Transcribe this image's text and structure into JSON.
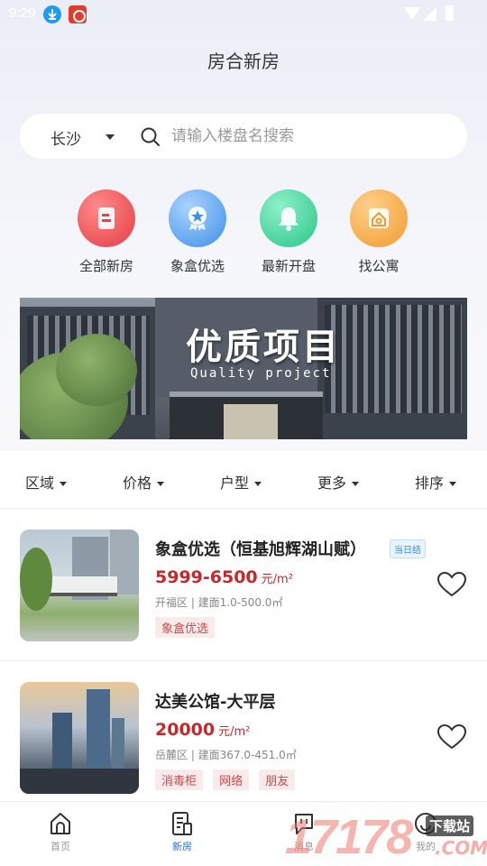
{
  "status_bar": {
    "time": "9:29"
  },
  "header": {
    "title": "房合新房"
  },
  "search": {
    "city": "长沙",
    "placeholder": "请输入楼盘名搜索"
  },
  "categories": [
    {
      "label": "全部新房",
      "icon": "building-card-icon",
      "color": "#e6414a"
    },
    {
      "label": "象盒优选",
      "icon": "star-badge-icon",
      "color": "#3f8fe8"
    },
    {
      "label": "最新开盘",
      "icon": "bell-icon",
      "color": "#27c58b"
    },
    {
      "label": "找公寓",
      "icon": "house-search-icon",
      "color": "#f29a2e"
    }
  ],
  "banner": {
    "title": "优质项目",
    "subtitle": "Quality project"
  },
  "filters": [
    "区域",
    "价格",
    "户型",
    "更多",
    "排序"
  ],
  "listings": [
    {
      "title": "象盒优选（恒基旭辉湖山赋）",
      "badge": "当日结",
      "price": "5999-6500",
      "unit": "元/m²",
      "meta": "开福区 | 建面1.0-500.0㎡",
      "tags": [
        "象盒优选"
      ]
    },
    {
      "title": "达美公馆-大平层",
      "badge": "",
      "price": "20000",
      "unit": "元/m²",
      "meta": "岳麓区 | 建面367.0-451.0㎡",
      "tags": [
        "消毒柜",
        "网络",
        "朋友"
      ]
    }
  ],
  "nav": [
    {
      "label": "首页",
      "icon": "home-icon",
      "active": false
    },
    {
      "label": "新房",
      "icon": "document-icon",
      "active": true
    },
    {
      "label": "消息",
      "icon": "message-icon",
      "active": false
    },
    {
      "label": "我的",
      "icon": "profile-icon",
      "active": false
    }
  ],
  "watermark": {
    "number": "17178",
    "site": "下载站",
    "domain": ".COM"
  },
  "colors": {
    "accent": "#2f6fe0",
    "price": "#c42a2a",
    "tag_text": "#c84b4b",
    "tag_bg": "#fbeaea"
  }
}
